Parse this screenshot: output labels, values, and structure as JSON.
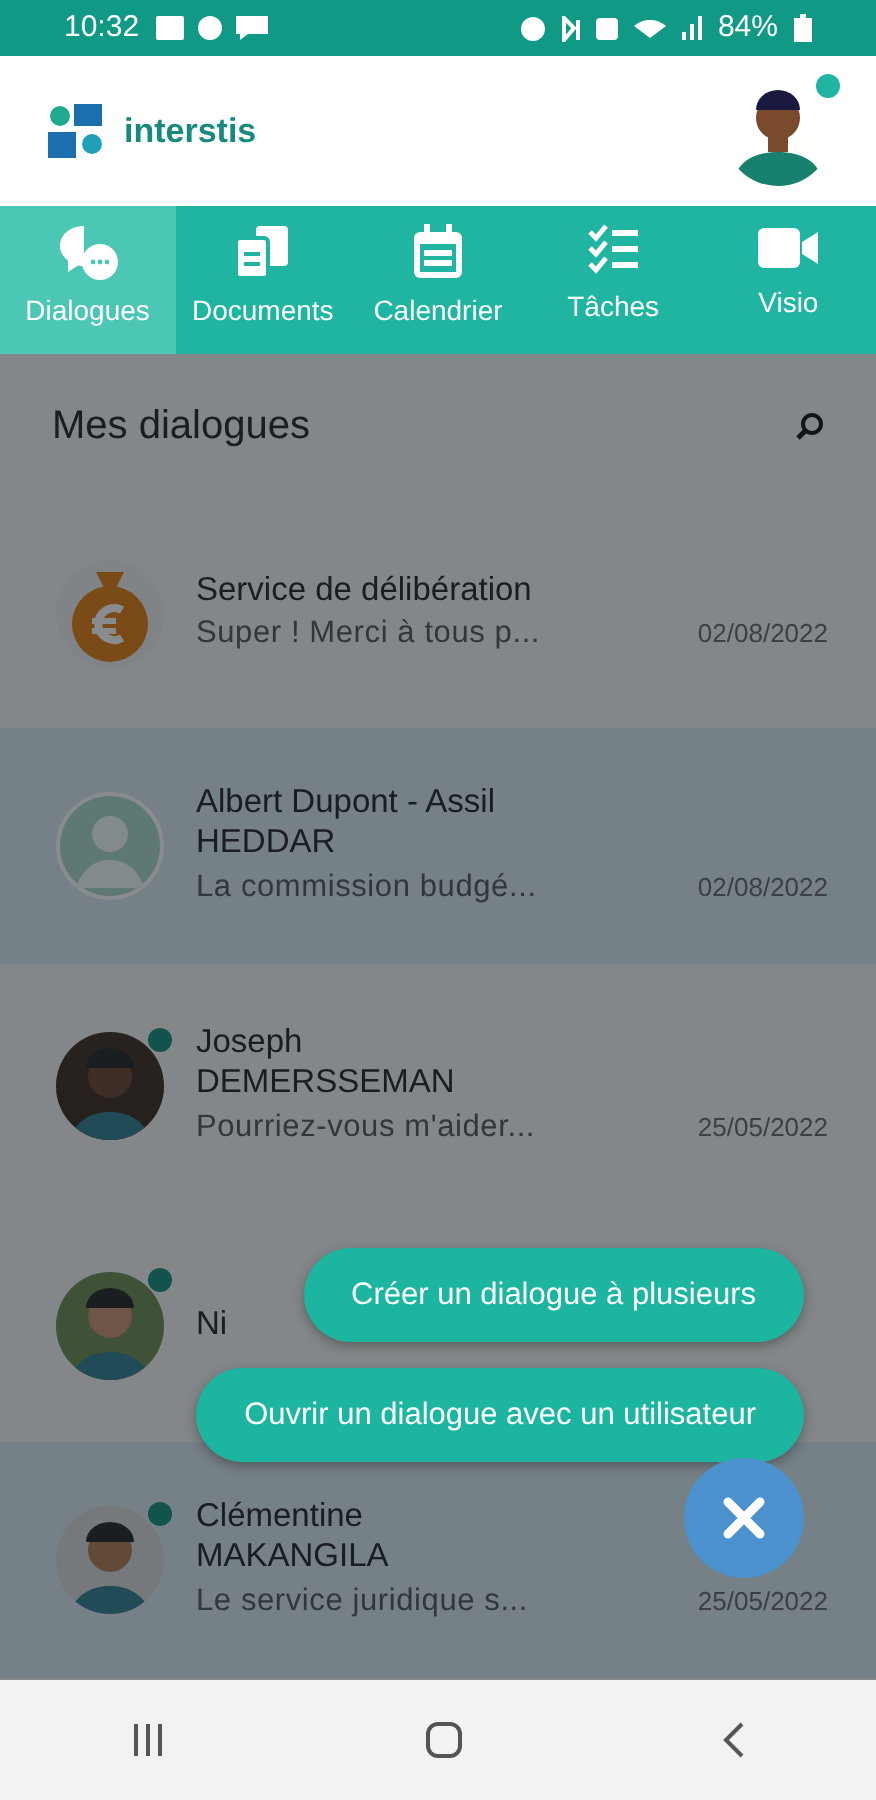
{
  "status_bar": {
    "time": "10:32",
    "battery": "84%"
  },
  "header": {
    "logo_text": "interstis",
    "user_online": true
  },
  "tabs": [
    {
      "label": "Dialogues",
      "selected": true
    },
    {
      "label": "Documents",
      "selected": false
    },
    {
      "label": "Calendrier",
      "selected": false
    },
    {
      "label": "Tâches",
      "selected": false
    },
    {
      "label": "Visio",
      "selected": false
    }
  ],
  "section_title": "Mes dialogues",
  "dialogues": [
    {
      "kind": "icon",
      "name": "Service de délibération",
      "message": "Super ! Merci à tous p...",
      "date": "02/08/2022",
      "online": false,
      "highlighted": false
    },
    {
      "kind": "default",
      "name": "Albert Dupont - Assil HEDDAR",
      "message": "La commission budgé...",
      "date": "02/08/2022",
      "online": false,
      "highlighted": true
    },
    {
      "name": "Joseph DEMERSSEMAN",
      "message": "Pourriez-vous m'aider...",
      "date": "25/05/2022",
      "online": true,
      "highlighted": false
    },
    {
      "name": "Ni",
      "online": true,
      "highlighted": false
    },
    {
      "name": "Clémentine MAKANGILA",
      "message": "Le service juridique s...",
      "date": "25/05/2022",
      "online": true,
      "highlighted": true
    }
  ],
  "fab_menu": {
    "open": true,
    "actions": [
      "Créer un dialogue à plusieurs",
      "Ouvrir un dialogue avec un utilisateur"
    ]
  }
}
